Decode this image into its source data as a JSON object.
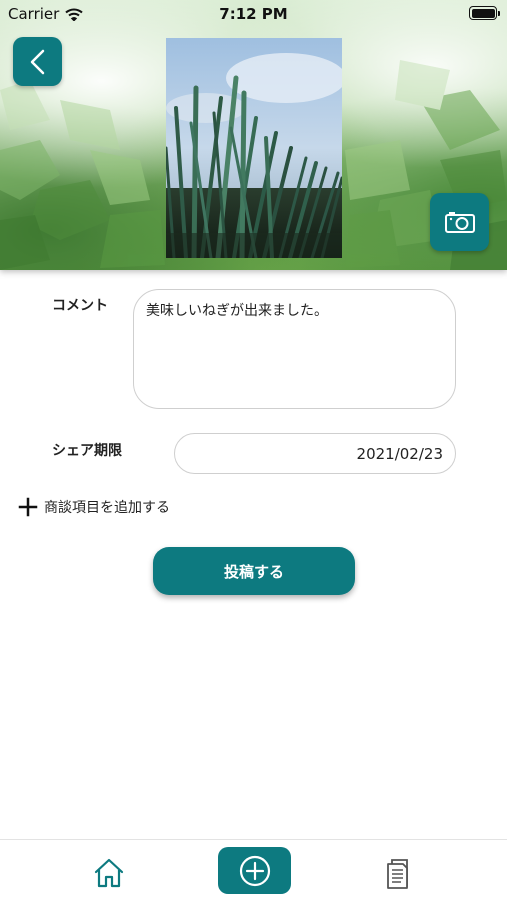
{
  "status_bar": {
    "carrier": "Carrier",
    "time": "7:12 PM"
  },
  "form": {
    "comment_label": "コメント",
    "comment_value": "美味しいねぎが出来ました。",
    "share_period_label": "シェア期限",
    "share_period_value": "2021/02/23",
    "add_item_label": "商談項目を追加する"
  },
  "actions": {
    "post_label": "投稿する"
  },
  "icons": {
    "back": "chevron-left-icon",
    "camera": "camera-icon",
    "home": "home-icon",
    "add": "plus-circle-icon",
    "docs": "document-icon"
  },
  "colors": {
    "accent": "#0d7a80"
  }
}
